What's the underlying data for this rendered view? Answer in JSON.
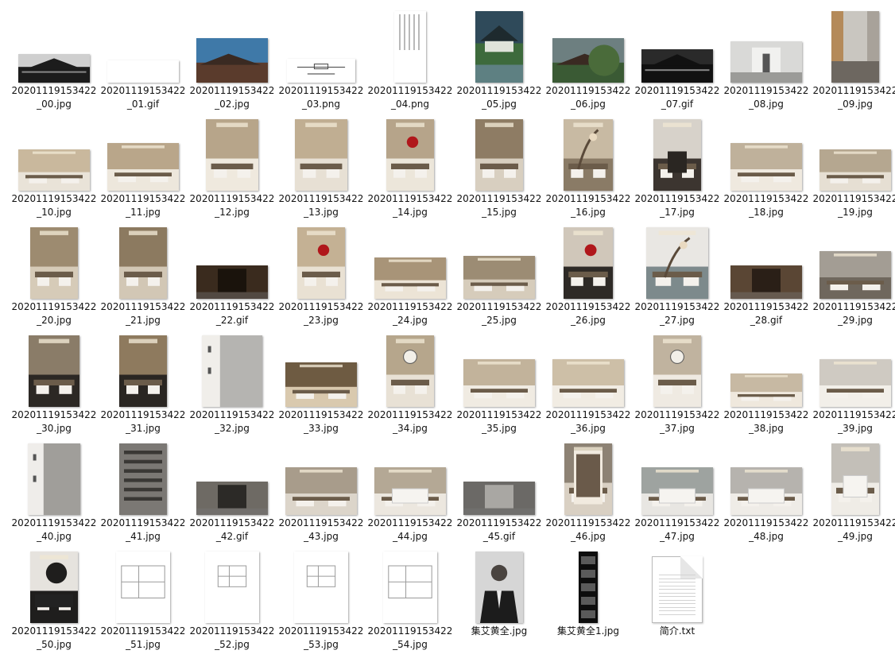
{
  "files": [
    {
      "name": "20201119153422_00.jpg",
      "thumb": {
        "w": 90,
        "h": 36,
        "c1": "#cfcfcf",
        "c2": "#1c1c1c",
        "style": "building-dark"
      }
    },
    {
      "name": "20201119153422_01.gif",
      "thumb": {
        "w": 90,
        "h": 28,
        "c1": "#ffffff",
        "c2": "#f2f2f2",
        "style": "blank"
      }
    },
    {
      "name": "20201119153422_02.jpg",
      "thumb": {
        "w": 90,
        "h": 56,
        "c1": "#3f79a8",
        "c2": "#5a3b2c",
        "style": "building-sky"
      }
    },
    {
      "name": "20201119153422_03.png",
      "thumb": {
        "w": 86,
        "h": 30,
        "c1": "#ffffff",
        "c2": "#444444",
        "style": "logo-card"
      }
    },
    {
      "name": "20201119153422_04.png",
      "thumb": {
        "w": 40,
        "h": 90,
        "c1": "#ffffff",
        "c2": "#8a8a8a",
        "style": "vertical-text"
      }
    },
    {
      "name": "20201119153422_05.jpg",
      "thumb": {
        "w": 60,
        "h": 90,
        "c1": "#2f4a5a",
        "c2": "#3d6a3c",
        "style": "pavilion"
      }
    },
    {
      "name": "20201119153422_06.jpg",
      "thumb": {
        "w": 90,
        "h": 56,
        "c1": "#6d7f80",
        "c2": "#3a5a34",
        "style": "building-trees"
      }
    },
    {
      "name": "20201119153422_07.gif",
      "thumb": {
        "w": 90,
        "h": 42,
        "c1": "#2a2a2a",
        "c2": "#111111",
        "style": "building-dark"
      }
    },
    {
      "name": "20201119153422_08.jpg",
      "thumb": {
        "w": 90,
        "h": 52,
        "c1": "#d9d9d7",
        "c2": "#9b9b98",
        "style": "gallery"
      }
    },
    {
      "name": "20201119153422_09.jpg",
      "thumb": {
        "w": 60,
        "h": 90,
        "c1": "#c9c6c0",
        "c2": "#6d6760",
        "style": "corridor"
      }
    },
    {
      "name": "20201119153422_10.jpg",
      "thumb": {
        "w": 90,
        "h": 52,
        "c1": "#c9b89d",
        "c2": "#e9e3d8",
        "style": "interior"
      }
    },
    {
      "name": "20201119153422_11.jpg",
      "thumb": {
        "w": 90,
        "h": 60,
        "c1": "#b9a68a",
        "c2": "#ede7dc",
        "style": "interior"
      }
    },
    {
      "name": "20201119153422_12.jpg",
      "thumb": {
        "w": 66,
        "h": 90,
        "c1": "#b7a58a",
        "c2": "#efe9de",
        "style": "interior-tall"
      }
    },
    {
      "name": "20201119153422_13.jpg",
      "thumb": {
        "w": 66,
        "h": 90,
        "c1": "#c0ae92",
        "c2": "#e7e0d4",
        "style": "interior-tall"
      }
    },
    {
      "name": "20201119153422_14.jpg",
      "thumb": {
        "w": 60,
        "h": 90,
        "c1": "#b6a48a",
        "c2": "#ece6da",
        "style": "interior-red"
      }
    },
    {
      "name": "20201119153422_15.jpg",
      "thumb": {
        "w": 60,
        "h": 90,
        "c1": "#8e7c64",
        "c2": "#d8cfc0",
        "style": "interior-tall"
      }
    },
    {
      "name": "20201119153422_16.jpg",
      "thumb": {
        "w": 62,
        "h": 90,
        "c1": "#c8baa3",
        "c2": "#8a7b66",
        "style": "tree-screen"
      }
    },
    {
      "name": "20201119153422_17.jpg",
      "thumb": {
        "w": 60,
        "h": 90,
        "c1": "#d7d2ca",
        "c2": "#3c3530",
        "style": "chair"
      }
    },
    {
      "name": "20201119153422_18.jpg",
      "thumb": {
        "w": 90,
        "h": 60,
        "c1": "#bfb19b",
        "c2": "#efe9df",
        "style": "interior"
      }
    },
    {
      "name": "20201119153422_19.jpg",
      "thumb": {
        "w": 90,
        "h": 52,
        "c1": "#b5a790",
        "c2": "#e6dfd3",
        "style": "interior"
      }
    },
    {
      "name": "20201119153422_20.jpg",
      "thumb": {
        "w": 60,
        "h": 90,
        "c1": "#9d8b70",
        "c2": "#d6cbb8",
        "style": "interior-tall"
      }
    },
    {
      "name": "20201119153422_21.jpg",
      "thumb": {
        "w": 60,
        "h": 90,
        "c1": "#8c7a60",
        "c2": "#d2c7b5",
        "style": "interior-tall"
      }
    },
    {
      "name": "20201119153422_22.gif",
      "thumb": {
        "w": 90,
        "h": 42,
        "c1": "#3a2b1e",
        "c2": "#1a130c",
        "style": "dark-panel"
      }
    },
    {
      "name": "20201119153422_23.jpg",
      "thumb": {
        "w": 60,
        "h": 90,
        "c1": "#c4b194",
        "c2": "#e9e1d3",
        "style": "interior-red"
      }
    },
    {
      "name": "20201119153422_24.jpg",
      "thumb": {
        "w": 90,
        "h": 52,
        "c1": "#a89478",
        "c2": "#ece4d6",
        "style": "interior"
      }
    },
    {
      "name": "20201119153422_25.jpg",
      "thumb": {
        "w": 90,
        "h": 54,
        "c1": "#9c8c74",
        "c2": "#d6ccbb",
        "style": "interior"
      }
    },
    {
      "name": "20201119153422_26.jpg",
      "thumb": {
        "w": 62,
        "h": 90,
        "c1": "#d0c7ba",
        "c2": "#2e2a26",
        "style": "interior-red"
      }
    },
    {
      "name": "20201119153422_27.jpg",
      "thumb": {
        "w": 78,
        "h": 90,
        "c1": "#e9e7e3",
        "c2": "#7d8a8c",
        "style": "tree-screen"
      }
    },
    {
      "name": "20201119153422_28.gif",
      "thumb": {
        "w": 90,
        "h": 42,
        "c1": "#5a4634",
        "c2": "#2a1f17",
        "style": "dark-panel"
      }
    },
    {
      "name": "20201119153422_29.jpg",
      "thumb": {
        "w": 90,
        "h": 60,
        "c1": "#a39d94",
        "c2": "#6f675d",
        "style": "interior"
      }
    },
    {
      "name": "20201119153422_30.jpg",
      "thumb": {
        "w": 64,
        "h": 90,
        "c1": "#8a7c68",
        "c2": "#2c2824",
        "style": "interior-tall"
      }
    },
    {
      "name": "20201119153422_31.jpg",
      "thumb": {
        "w": 60,
        "h": 90,
        "c1": "#8e7a5e",
        "c2": "#2a2622",
        "style": "interior-tall"
      }
    },
    {
      "name": "20201119153422_32.jpg",
      "thumb": {
        "w": 76,
        "h": 90,
        "c1": "#f0eeea",
        "c2": "#8d8d8b",
        "style": "marble-card"
      }
    },
    {
      "name": "20201119153422_33.jpg",
      "thumb": {
        "w": 90,
        "h": 56,
        "c1": "#6e5b42",
        "c2": "#d9c9ae",
        "style": "interior"
      }
    },
    {
      "name": "20201119153422_34.jpg",
      "thumb": {
        "w": 60,
        "h": 90,
        "c1": "#b6a68c",
        "c2": "#e8e1d5",
        "style": "round-window"
      }
    },
    {
      "name": "20201119153422_35.jpg",
      "thumb": {
        "w": 90,
        "h": 60,
        "c1": "#c2b39b",
        "c2": "#f0ebe2",
        "style": "interior"
      }
    },
    {
      "name": "20201119153422_36.jpg",
      "thumb": {
        "w": 90,
        "h": 60,
        "c1": "#cdbfa7",
        "c2": "#f1ece3",
        "style": "interior"
      }
    },
    {
      "name": "20201119153422_37.jpg",
      "thumb": {
        "w": 60,
        "h": 90,
        "c1": "#c0b39f",
        "c2": "#efeae2",
        "style": "round-window"
      }
    },
    {
      "name": "20201119153422_38.jpg",
      "thumb": {
        "w": 90,
        "h": 42,
        "c1": "#c7b9a3",
        "c2": "#efe8dd",
        "style": "interior"
      }
    },
    {
      "name": "20201119153422_39.jpg",
      "thumb": {
        "w": 90,
        "h": 60,
        "c1": "#cfcac2",
        "c2": "#f2efe9",
        "style": "interior"
      }
    },
    {
      "name": "20201119153422_40.jpg",
      "thumb": {
        "w": 66,
        "h": 90,
        "c1": "#efedea",
        "c2": "#6b6964",
        "style": "bedroom-card"
      }
    },
    {
      "name": "20201119153422_41.jpg",
      "thumb": {
        "w": 60,
        "h": 90,
        "c1": "#7b7874",
        "c2": "#3a3835",
        "style": "stair"
      }
    },
    {
      "name": "20201119153422_42.gif",
      "thumb": {
        "w": 90,
        "h": 42,
        "c1": "#6e6a64",
        "c2": "#2c2a27",
        "style": "dark-panel"
      }
    },
    {
      "name": "20201119153422_43.jpg",
      "thumb": {
        "w": 90,
        "h": 60,
        "c1": "#a89c8b",
        "c2": "#dcd5ca",
        "style": "interior"
      }
    },
    {
      "name": "20201119153422_44.jpg",
      "thumb": {
        "w": 90,
        "h": 60,
        "c1": "#b4a895",
        "c2": "#ece7df",
        "style": "bedroom"
      }
    },
    {
      "name": "20201119153422_45.gif",
      "thumb": {
        "w": 90,
        "h": 42,
        "c1": "#6b6966",
        "c2": "#a9a7a3",
        "style": "dark-panel"
      }
    },
    {
      "name": "20201119153422_46.jpg",
      "thumb": {
        "w": 60,
        "h": 90,
        "c1": "#8d8274",
        "c2": "#d9d0c3",
        "style": "closet"
      }
    },
    {
      "name": "20201119153422_47.jpg",
      "thumb": {
        "w": 90,
        "h": 60,
        "c1": "#9ea3a0",
        "c2": "#e8e6e2",
        "style": "bedroom"
      }
    },
    {
      "name": "20201119153422_48.jpg",
      "thumb": {
        "w": 90,
        "h": 60,
        "c1": "#b6b3ae",
        "c2": "#efece7",
        "style": "bedroom"
      }
    },
    {
      "name": "20201119153422_49.jpg",
      "thumb": {
        "w": 60,
        "h": 90,
        "c1": "#c3bfb8",
        "c2": "#efece6",
        "style": "bedroom"
      }
    },
    {
      "name": "20201119153422_50.jpg",
      "thumb": {
        "w": 60,
        "h": 90,
        "c1": "#e6e3de",
        "c2": "#1f1e1d",
        "style": "mirror"
      }
    },
    {
      "name": "20201119153422_51.jpg",
      "thumb": {
        "w": 68,
        "h": 90,
        "c1": "#ffffff",
        "c2": "#9a9a9a",
        "style": "floorplan"
      }
    },
    {
      "name": "20201119153422_52.jpg",
      "thumb": {
        "w": 68,
        "h": 90,
        "c1": "#ffffff",
        "c2": "#9a9a9a",
        "style": "floorplan-small"
      }
    },
    {
      "name": "20201119153422_53.jpg",
      "thumb": {
        "w": 68,
        "h": 90,
        "c1": "#ffffff",
        "c2": "#9a9a9a",
        "style": "floorplan-small"
      }
    },
    {
      "name": "20201119153422_54.jpg",
      "thumb": {
        "w": 68,
        "h": 90,
        "c1": "#ffffff",
        "c2": "#9a9a9a",
        "style": "floorplan"
      }
    },
    {
      "name": "集艾黄全.jpg",
      "thumb": {
        "w": 60,
        "h": 90,
        "c1": "#d6d6d6",
        "c2": "#1c1c1c",
        "style": "portrait"
      }
    },
    {
      "name": "集艾黄全1.jpg",
      "thumb": {
        "w": 24,
        "h": 90,
        "c1": "#0d0d0d",
        "c2": "#5a5a5a",
        "style": "strip"
      }
    },
    {
      "name": "简介.txt",
      "thumb": {
        "w": 62,
        "h": 82,
        "c1": "#ffffff",
        "c2": "#d3d3d3",
        "style": "txt"
      }
    }
  ]
}
